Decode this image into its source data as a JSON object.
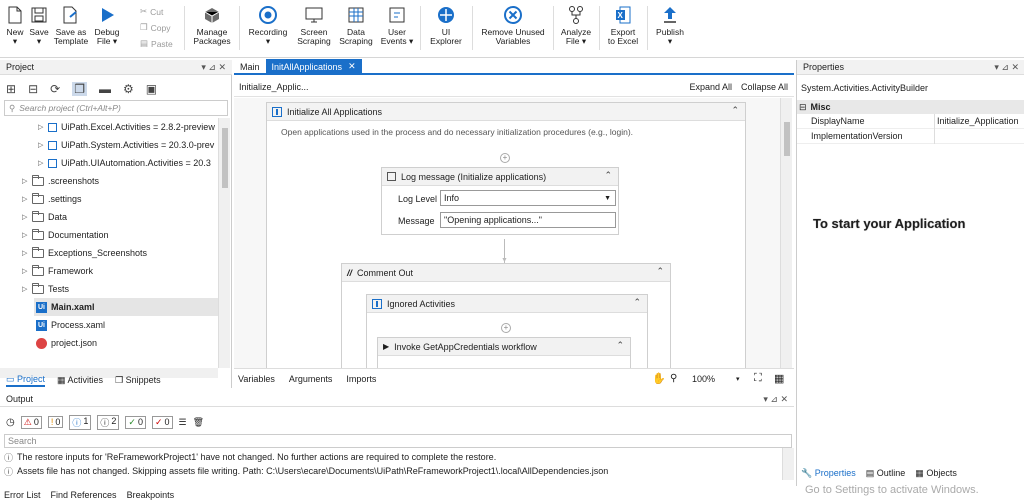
{
  "ribbon": {
    "buttons": [
      {
        "id": "new",
        "label": "New\n▾"
      },
      {
        "id": "save",
        "label": "Save\n▾"
      },
      {
        "id": "save_template",
        "label": "Save as\nTemplate"
      },
      {
        "id": "debug",
        "label": "Debug\nFile ▾"
      },
      {
        "id": "manage_packages",
        "label": "Manage\nPackages"
      },
      {
        "id": "recording",
        "label": "Recording\n▾"
      },
      {
        "id": "screen_scraping",
        "label": "Screen\nScraping"
      },
      {
        "id": "data_scraping",
        "label": "Data\nScraping"
      },
      {
        "id": "user_events",
        "label": "User\nEvents ▾"
      },
      {
        "id": "ui_explorer",
        "label": "UI\nExplorer"
      },
      {
        "id": "remove_unused",
        "label": "Remove Unused\nVariables"
      },
      {
        "id": "analyze",
        "label": "Analyze\nFile ▾"
      },
      {
        "id": "export_excel",
        "label": "Export\nto Excel"
      },
      {
        "id": "publish",
        "label": "Publish\n▾"
      }
    ],
    "cut": "Cut",
    "copy": "Copy",
    "paste": "Paste"
  },
  "project": {
    "title": "Project",
    "search_placeholder": "Search project (Ctrl+Alt+P)",
    "items": [
      {
        "label": "UiPath.Excel.Activities = 2.8.2-preview",
        "kind": "pkg"
      },
      {
        "label": "UiPath.System.Activities = 20.3.0-prev",
        "kind": "pkg"
      },
      {
        "label": "UiPath.UIAutomation.Activities = 20.3",
        "kind": "pkg"
      },
      {
        "label": ".screenshots",
        "kind": "folder"
      },
      {
        "label": ".settings",
        "kind": "folder"
      },
      {
        "label": "Data",
        "kind": "folder"
      },
      {
        "label": "Documentation",
        "kind": "folder"
      },
      {
        "label": "Exceptions_Screenshots",
        "kind": "folder"
      },
      {
        "label": "Framework",
        "kind": "folder"
      },
      {
        "label": "Tests",
        "kind": "folder"
      },
      {
        "label": "Main.xaml",
        "kind": "xaml"
      },
      {
        "label": "Process.xaml",
        "kind": "xaml"
      },
      {
        "label": "project.json",
        "kind": "json"
      }
    ],
    "tabs": [
      "Project",
      "Activities",
      "Snippets"
    ]
  },
  "designer": {
    "tabs": [
      "Main",
      "InitAllApplications"
    ],
    "breadcrumb": "Initialize_Applic...",
    "expand_all": "Expand All",
    "collapse_all": "Collapse All",
    "seq_title": "Initialize All Applications",
    "seq_desc": "Open applications used in the process and do necessary initialization procedures (e.g., login).",
    "log_title": "Log message (Initialize applications)",
    "log_level_label": "Log Level",
    "log_level_value": "Info",
    "message_label": "Message",
    "message_value": "\"Opening applications...\"",
    "comment_title": "Comment Out",
    "ignored_title": "Ignored Activities",
    "invoke_title": "Invoke GetAppCredentials workflow",
    "bottom_tabs": [
      "Variables",
      "Arguments",
      "Imports"
    ],
    "zoom": "100%"
  },
  "properties": {
    "title": "Properties",
    "type": "System.Activities.ActivityBuilder",
    "category": "Misc",
    "rows": [
      {
        "name": "DisplayName",
        "value": "Initialize_Application"
      },
      {
        "name": "ImplementationVersion",
        "value": ""
      }
    ],
    "overlay": "To start your Application",
    "tabs": [
      "Properties",
      "Outline",
      "Objects"
    ],
    "watermark": "Go to Settings to activate Windows."
  },
  "output": {
    "title": "Output",
    "counts": [
      "0",
      "0",
      "1",
      "2",
      "0",
      "0"
    ],
    "search_placeholder": "Search",
    "messages": [
      "The restore inputs for 'ReFrameworkProject1' have not changed. No further actions are required to complete the restore.",
      "Assets file has not changed. Skipping assets file writing. Path: C:\\Users\\ecare\\Documents\\UiPath\\ReFrameworkProject1\\.local\\AllDependencies.json"
    ],
    "bottom_tabs": [
      "Error List",
      "Find References",
      "Breakpoints"
    ]
  }
}
